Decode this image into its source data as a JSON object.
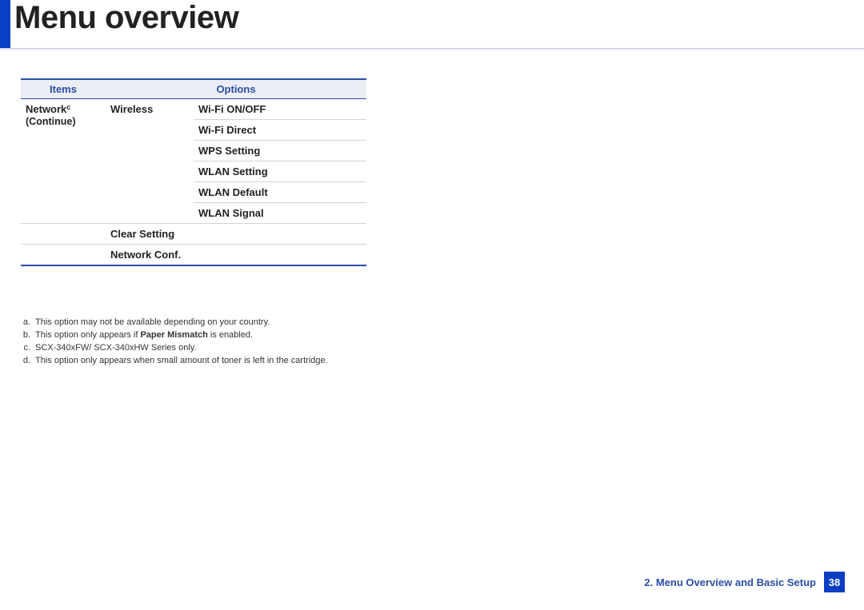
{
  "title": "Menu overview",
  "table": {
    "headers": {
      "items": "Items",
      "options": "Options"
    },
    "item": {
      "name": "Network",
      "sup": "c",
      "continue": "(Continue)"
    },
    "group": "Wireless",
    "wireless_subs": [
      "Wi-Fi ON/OFF",
      "Wi-Fi Direct",
      "WPS Setting",
      "WLAN Setting",
      "WLAN Default",
      "WLAN Signal"
    ],
    "clear_setting": "Clear Setting",
    "network_conf": "Network Conf."
  },
  "footnotes": {
    "a": {
      "label": "a.",
      "text": "This option may not be available depending on your country."
    },
    "b": {
      "label": "b.",
      "prefix": "This option only appears if ",
      "bold": "Paper Mismatch",
      "suffix": " is enabled."
    },
    "c": {
      "label": "c.",
      "text": "SCX-340xFW/ SCX-340xHW Series only."
    },
    "d": {
      "label": "d.",
      "text": "This option only appears when small amount of toner is left in the cartridge."
    }
  },
  "footer": {
    "chapter": "2.  Menu Overview and Basic Setup",
    "page": "38"
  }
}
